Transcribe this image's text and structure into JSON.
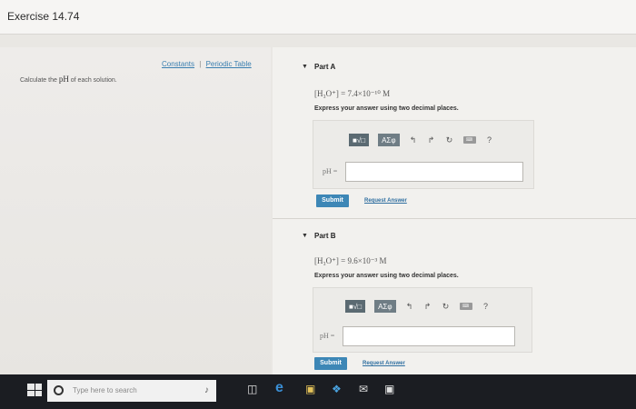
{
  "window": {
    "title": "Exercise 14.74"
  },
  "left": {
    "links": {
      "constants": "Constants",
      "separator": "|",
      "periodic_table": "Periodic Table"
    },
    "prompt_pre": "Calculate the",
    "prompt_ph": "pH",
    "prompt_post": "of each solution."
  },
  "parts": [
    {
      "label": "Part A",
      "formula": "[H₃O⁺] = 7.4×10⁻¹⁰ M",
      "instructions": "Express your answer using two decimal places.",
      "toolbar": {
        "template": "■√□",
        "symbols": "AΣφ",
        "undo": "↰",
        "redo": "↱",
        "reset": "↻",
        "keyboard": "⌨",
        "help": "?"
      },
      "input_label": "pH =",
      "submit": "Submit",
      "request": "Request Answer"
    },
    {
      "label": "Part B",
      "formula": "[H₃O⁺] = 9.6×10⁻³ M",
      "instructions": "Express your answer using two decimal places.",
      "toolbar": {
        "template": "■√□",
        "symbols": "AΣφ",
        "undo": "↰",
        "redo": "↱",
        "reset": "↻",
        "keyboard": "⌨",
        "help": "?"
      },
      "input_label": "pH =",
      "submit": "Submit",
      "request": "Request Answer"
    }
  ],
  "taskbar": {
    "search_placeholder": "Type here to search",
    "icons": [
      "mic-icon",
      "task-view-icon",
      "edge-icon",
      "file-explorer-icon",
      "dropbox-icon",
      "mail-icon",
      "store-icon"
    ]
  }
}
